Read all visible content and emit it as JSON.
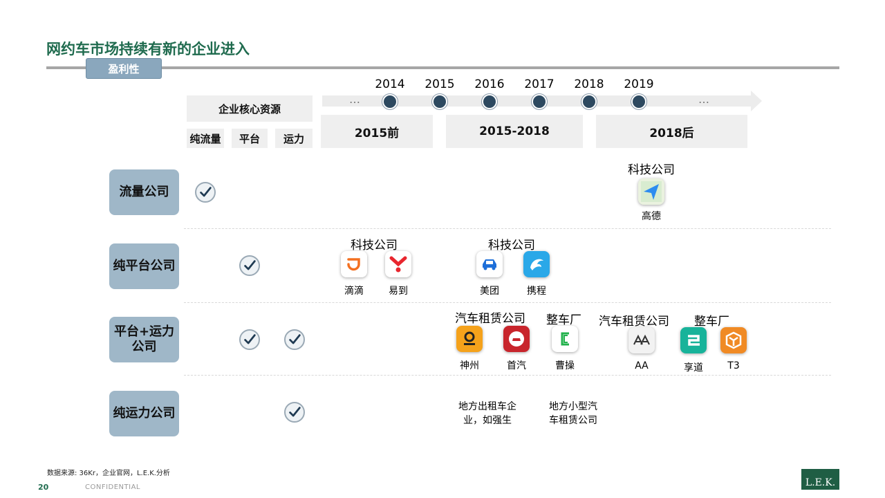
{
  "slide": {
    "title": "网约车市场持续有新的企业进入",
    "tag": "盈利性",
    "source": "数据来源: 36Kr，企业官网，L.E.K.分析",
    "page_number": "20",
    "confidential": "CONFIDENTIAL",
    "logo_text": "L.E.K."
  },
  "resources": {
    "header": "企业核心资源",
    "columns": [
      "纯流量",
      "平台",
      "运力"
    ]
  },
  "timeline": {
    "years": [
      "2014",
      "2015",
      "2016",
      "2017",
      "2018",
      "2019"
    ],
    "ellipsis": "…",
    "periods": [
      "2015前",
      "2015-2018",
      "2018后"
    ]
  },
  "rows": [
    {
      "label_line1": "流量公司",
      "label_line2": "",
      "checks": [
        true,
        false,
        false
      ]
    },
    {
      "label_line1": "纯平台公司",
      "label_line2": "",
      "checks": [
        false,
        true,
        false
      ]
    },
    {
      "label_line1": "平台+运力",
      "label_line2": "公司",
      "checks": [
        false,
        true,
        true
      ]
    },
    {
      "label_line1": "纯运力公司",
      "label_line2": "",
      "checks": [
        false,
        false,
        true
      ]
    }
  ],
  "groups": {
    "tech_1": "科技公司",
    "tech_2": "科技公司",
    "tech_3": "科技公司",
    "rental_1": "汽车租赁公司",
    "oem_1": "整车厂",
    "rental_2": "汽车租赁公司",
    "oem_2": "整车厂"
  },
  "apps": {
    "gaode": {
      "name": "高德",
      "icon": "gaode-map-icon",
      "color": "#2d8cf0"
    },
    "didi": {
      "name": "滴滴",
      "icon": "didi-icon",
      "color": "#f37021"
    },
    "yidao": {
      "name": "易到",
      "icon": "yidao-icon",
      "color": "#e8262e"
    },
    "meituan": {
      "name": "美团",
      "icon": "meituan-car-icon",
      "color": "#1e6fd9"
    },
    "ctrip": {
      "name": "携程",
      "icon": "ctrip-dolphin-icon",
      "color": "#2aa8e8"
    },
    "shenzhou": {
      "name": "神州",
      "icon": "shenzhou-icon",
      "color": "#f5a21b"
    },
    "shouqi": {
      "name": "首汽",
      "icon": "shouqi-icon",
      "color": "#c8252c"
    },
    "caocao": {
      "name": "曹操",
      "icon": "caocao-icon",
      "color": "#22b24c"
    },
    "aa": {
      "name": "AA",
      "icon": "aa-icon",
      "color": "#333333"
    },
    "xiangdao": {
      "name": "享道",
      "icon": "xiangdao-icon",
      "color": "#18b39a"
    },
    "t3": {
      "name": "T3",
      "icon": "t3-icon",
      "color": "#f08a24"
    }
  },
  "notes": {
    "taxi_line1": "地方出租车企",
    "taxi_line2": "业，如强生",
    "rental_line1": "地方小型汽",
    "rental_line2": "车租赁公司"
  }
}
